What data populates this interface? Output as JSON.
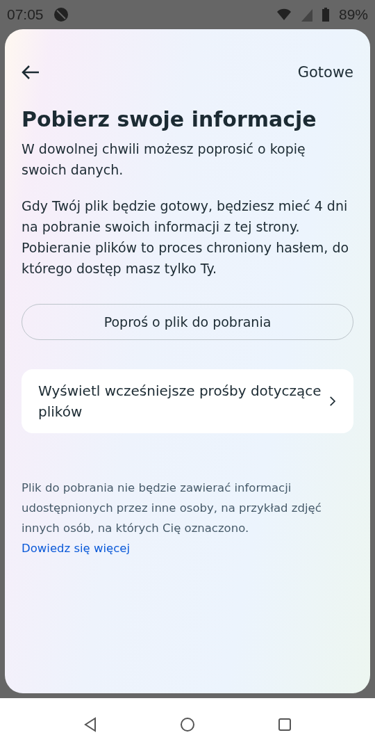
{
  "status_bar": {
    "time": "07:05",
    "battery": "89%"
  },
  "header": {
    "done": "Gotowe"
  },
  "title": "Pobierz swoje informacje",
  "paragraphs": [
    "W dowolnej chwili możesz poprosić o kopię swoich danych.",
    "Gdy Twój plik będzie gotowy, będziesz mieć 4 dni na pobranie swoich informacji z tej strony. Pobieranie plików to proces chroniony hasłem, do którego dostęp masz tylko Ty."
  ],
  "request_button": "Poproś o plik do pobrania",
  "history_item": "Wyświetl wcześniejsze prośby dotyczące plików",
  "note": {
    "text": "Plik do pobrania nie będzie zawierać informacji udostępnionych przez inne osoby, na przykład zdjęć innych osób, na których Cię oznaczono.",
    "link": "Dowiedz się więcej"
  }
}
